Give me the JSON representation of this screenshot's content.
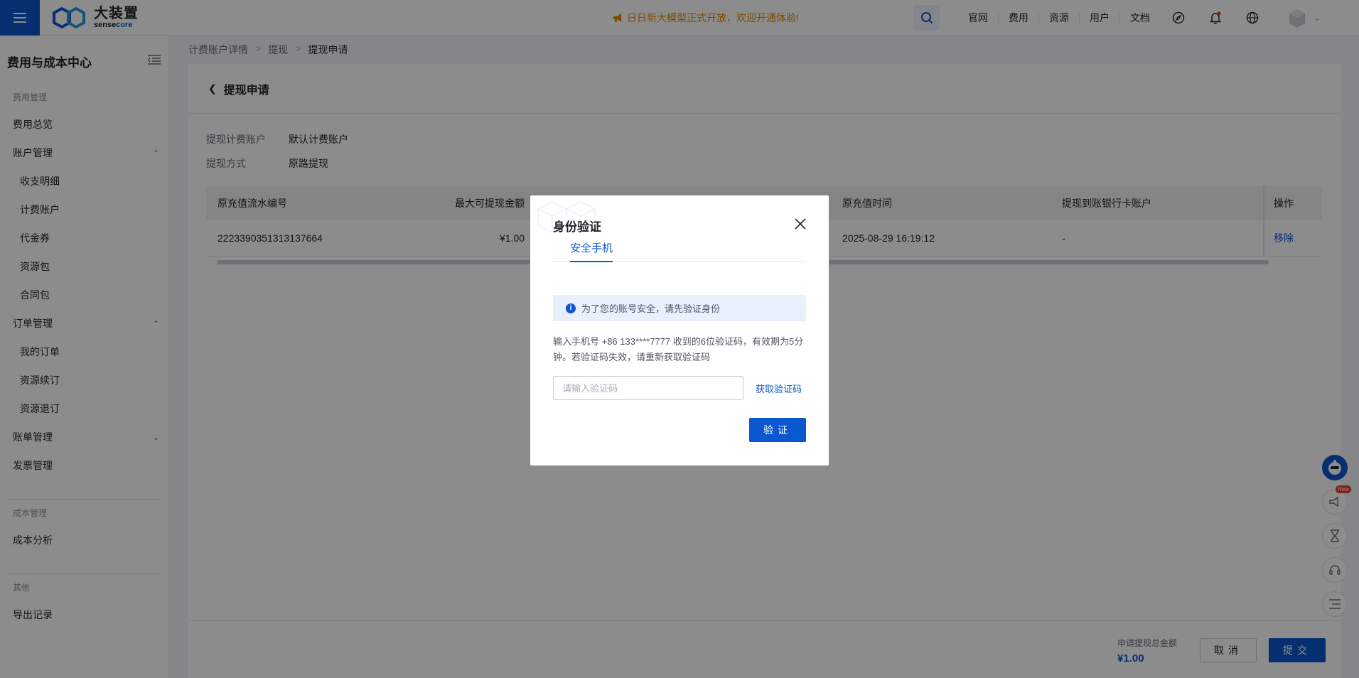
{
  "topbar": {
    "logo_cn": "大装置",
    "logo_en_a": "sense",
    "logo_en_b": "core",
    "announcement": "日日新大模型正式开放，欢迎开通体验!",
    "links": [
      "官网",
      "费用",
      "资源",
      "用户",
      "文档"
    ]
  },
  "sidebar": {
    "title": "费用与成本中心",
    "sections": {
      "fee": "费用管理",
      "cost": "成本管理",
      "other": "其他"
    },
    "items": {
      "overview": "费用总览",
      "account": "账户管理",
      "income": "收支明细",
      "billing_account": "计费账户",
      "voucher": "代金券",
      "resource_pack": "资源包",
      "contract_pack": "合同包",
      "order": "订单管理",
      "my_orders": "我的订单",
      "renew": "资源续订",
      "refund": "资源退订",
      "bill": "账单管理",
      "invoice": "发票管理",
      "cost_analysis": "成本分析",
      "export": "导出记录"
    }
  },
  "breadcrumb": [
    "计费账户详情",
    "提现",
    "提现申请"
  ],
  "page": {
    "title": "提现申请",
    "fields": [
      {
        "label": "提现计费账户",
        "value": "默认计费账户"
      },
      {
        "label": "提现方式",
        "value": "原路提现"
      }
    ],
    "table": {
      "headers": [
        "原充值流水编号",
        "最大可提现金额",
        "原充值时间",
        "提现到账银行卡账户",
        "操作"
      ],
      "rows": [
        {
          "id": "2223390351313137664",
          "amount": "¥1.00",
          "time": "2025-08-29 16:19:12",
          "bank": "-",
          "action": "移除"
        }
      ]
    },
    "footer": {
      "sum_label": "申请提现总金额",
      "sum_value": "¥1.00",
      "cancel": "取消",
      "submit": "提交"
    }
  },
  "modal": {
    "title": "身份验证",
    "tab": "安全手机",
    "notice": "为了您的账号安全，请先验证身份",
    "desc": "输入手机号 +86 133****7777 收到的6位验证码，有效期为5分钟。若验证码失效，请重新获取验证码",
    "input_placeholder": "请输入验证码",
    "get_code": "获取验证码",
    "verify": "验证"
  },
  "float_tools": {
    "new_badge": "New"
  },
  "colors": {
    "primary": "#0b57d0",
    "announcement": "#e08a00"
  }
}
